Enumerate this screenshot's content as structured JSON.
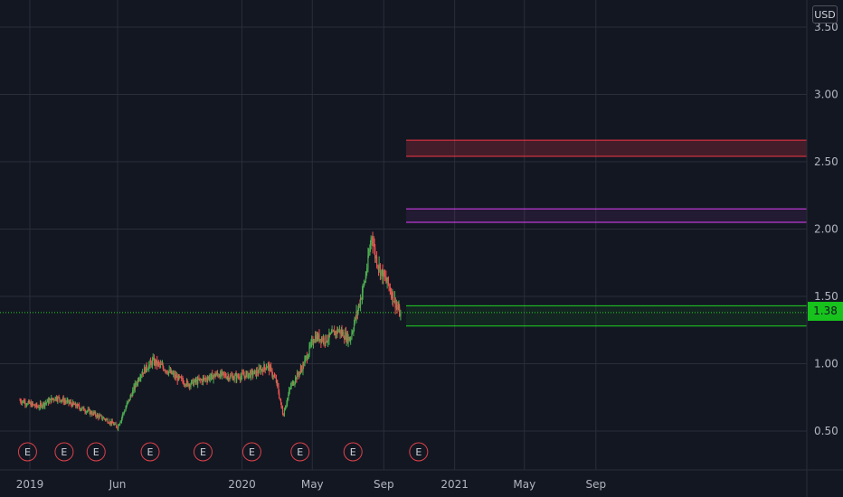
{
  "currency": "USD",
  "current_price": "1.38",
  "colors": {
    "background": "#131722",
    "grid": "#2a2e39",
    "up": "#26a69a",
    "up_candle": "#4caf50",
    "down_candle": "#ef5350",
    "red_zone": "#f23645",
    "magenta_zone": "#e040fb",
    "green_zone": "#22d322",
    "earnings": "#e0424a"
  },
  "chart_data": {
    "type": "candlestick",
    "title": "",
    "y_ticks": [
      "3.50",
      "3.00",
      "2.50",
      "2.00",
      "1.50",
      "1.00",
      "0.50"
    ],
    "x_ticks": [
      "2019",
      "Jun",
      "2020",
      "May",
      "Sep",
      "2021",
      "May",
      "Sep"
    ],
    "ylim": [
      0.15,
      3.5
    ],
    "current_price": 1.38,
    "zones": [
      {
        "name": "red",
        "low": 2.54,
        "high": 2.66,
        "color": "#f23645"
      },
      {
        "name": "magenta",
        "low": 2.05,
        "high": 2.15,
        "color": "#e040fb"
      },
      {
        "name": "green",
        "low": 1.28,
        "high": 1.43,
        "color": "#22d322"
      }
    ],
    "earnings_markers": [
      "E",
      "E",
      "E",
      "E",
      "E",
      "E",
      "E",
      "E",
      "E"
    ],
    "price_path": [
      [
        "2018-12-15",
        0.73
      ],
      [
        "2019-01-15",
        0.68
      ],
      [
        "2019-02-15",
        0.75
      ],
      [
        "2019-03-15",
        0.7
      ],
      [
        "2019-04-15",
        0.64
      ],
      [
        "2019-05-15",
        0.58
      ],
      [
        "2019-06-01",
        0.53
      ],
      [
        "2019-06-20",
        0.72
      ],
      [
        "2019-07-10",
        0.92
      ],
      [
        "2019-08-01",
        1.02
      ],
      [
        "2019-08-20",
        0.97
      ],
      [
        "2019-09-10",
        0.9
      ],
      [
        "2019-10-01",
        0.85
      ],
      [
        "2019-10-25",
        0.88
      ],
      [
        "2019-11-20",
        0.92
      ],
      [
        "2019-12-20",
        0.9
      ],
      [
        "2020-01-25",
        0.93
      ],
      [
        "2020-02-15",
        0.99
      ],
      [
        "2020-03-01",
        0.86
      ],
      [
        "2020-03-12",
        0.62
      ],
      [
        "2020-03-25",
        0.83
      ],
      [
        "2020-04-15",
        0.98
      ],
      [
        "2020-05-05",
        1.2
      ],
      [
        "2020-05-25",
        1.18
      ],
      [
        "2020-06-15",
        1.25
      ],
      [
        "2020-07-05",
        1.18
      ],
      [
        "2020-07-20",
        1.42
      ],
      [
        "2020-07-30",
        1.6
      ],
      [
        "2020-08-05",
        1.75
      ],
      [
        "2020-08-12",
        1.97
      ],
      [
        "2020-08-18",
        1.8
      ],
      [
        "2020-08-28",
        1.68
      ],
      [
        "2020-09-10",
        1.58
      ],
      [
        "2020-09-22",
        1.45
      ],
      [
        "2020-10-01",
        1.35
      ]
    ]
  }
}
